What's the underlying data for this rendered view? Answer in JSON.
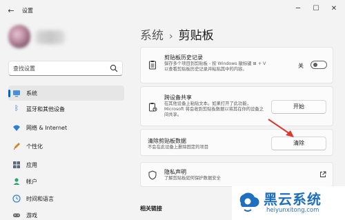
{
  "window": {
    "title": "设置",
    "back_icon": "arrow-left-icon",
    "controls": [
      "minimize-icon",
      "maximize-icon",
      "close-icon"
    ]
  },
  "search": {
    "placeholder": "查找设置"
  },
  "sidebar": {
    "items": [
      {
        "label": "系统",
        "icon": "system-icon",
        "active": true
      },
      {
        "label": "蓝牙和其他设备",
        "icon": "bluetooth-icon",
        "active": false
      },
      {
        "label": "网络 & Internet",
        "icon": "network-icon",
        "active": false
      },
      {
        "label": "个性化",
        "icon": "personalization-icon",
        "active": false
      },
      {
        "label": "应用",
        "icon": "apps-icon",
        "active": false
      },
      {
        "label": "帐户",
        "icon": "account-icon",
        "active": false
      },
      {
        "label": "时间和语言",
        "icon": "time-language-icon",
        "active": false
      },
      {
        "label": "游戏",
        "icon": "gaming-icon",
        "active": false
      }
    ]
  },
  "breadcrumb": {
    "parent": "系统",
    "separator": "›",
    "current": "剪贴板"
  },
  "cards": {
    "history": {
      "title": "剪贴板历史记录",
      "desc": "保存多个项目到剪贴板 - 按 Windows 徽标键 ⊞ + V 以查看剪贴板历史记录并粘贴其中的内容。",
      "toggle_label": "关",
      "toggle_on": false
    },
    "sync": {
      "title": "跨设备共享",
      "desc": "在其他设备上粘贴文本。如果打开了此功能，Microsoft 将会收到剪贴板数据以将其在你的设备之间共享。",
      "button": "开始"
    },
    "clear": {
      "title": "清除剪贴板数据",
      "desc": "不会在此设备上删除固定的项目",
      "button": "清除"
    },
    "privacy": {
      "title": "隐私声明",
      "desc": "了解剪贴板如何保护数据安全"
    }
  },
  "related": {
    "heading": "相关链接"
  },
  "watermark": {
    "title": "黑云系统",
    "url": "heiyunxitong.com"
  },
  "colors": {
    "accent": "#0067c0",
    "background": "#f3f3f3",
    "card": "#fbfbfb",
    "annotation_arrow": "#e0362c"
  }
}
